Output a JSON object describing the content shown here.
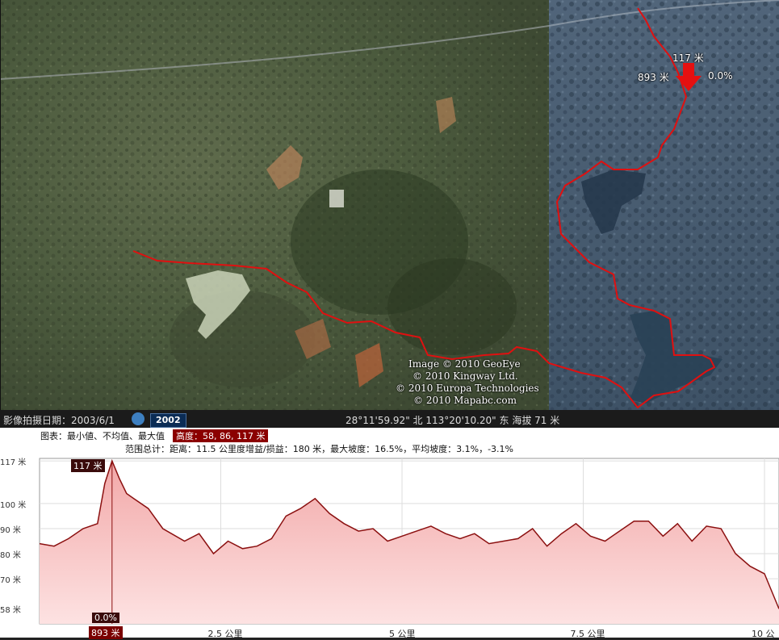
{
  "map": {
    "credits": [
      "Image © 2010 GeoEye",
      "© 2010 Kingway Ltd.",
      "© 2010 Europa Technologies",
      "© 2010 Mapabc.com"
    ],
    "marker": {
      "elevation": "117 米",
      "distance": "893 米",
      "slope": "0.0%"
    }
  },
  "status": {
    "imagery_date_label": "影像拍摄日期：2003/6/1",
    "year": "2002",
    "coords": "28°11'59.92\" 北  113°20'10.20\" 东 海拔   71 米"
  },
  "profile": {
    "header_left": "图表：最小値、不均值、最大值",
    "header_highlight": "高度：58, 86, 117 米",
    "summary": "范围总计：距离：11.5 公里度增益/损益：180 米，最大坡度：16.5%，平均坡度：3.1%，-3.1%",
    "cursor_elev": "117 米",
    "cursor_slope": "0.0%",
    "cursor_dist": "893 米"
  },
  "chart_data": {
    "type": "area",
    "title": "",
    "xlabel": "",
    "ylabel": "",
    "ylim": [
      52,
      118
    ],
    "xlim": [
      0,
      10.2
    ],
    "yticks": [
      "117 米",
      "100 米",
      "90 米",
      "80 米",
      "70 米",
      "58 米"
    ],
    "xticks": [
      "2.5 公里",
      "5 公里",
      "7.5 公里",
      "10 公"
    ],
    "x": [
      0,
      0.2,
      0.4,
      0.6,
      0.8,
      0.9,
      1.0,
      1.1,
      1.2,
      1.3,
      1.5,
      1.7,
      2.0,
      2.2,
      2.4,
      2.6,
      2.8,
      3.0,
      3.2,
      3.4,
      3.6,
      3.8,
      4.0,
      4.2,
      4.4,
      4.6,
      4.8,
      5.0,
      5.2,
      5.4,
      5.6,
      5.8,
      6.0,
      6.2,
      6.4,
      6.6,
      6.8,
      7.0,
      7.2,
      7.4,
      7.6,
      7.8,
      8.0,
      8.2,
      8.4,
      8.6,
      8.8,
      9.0,
      9.2,
      9.4,
      9.6,
      9.8,
      10.0,
      10.2
    ],
    "y": [
      84,
      83,
      86,
      90,
      92,
      108,
      117,
      110,
      104,
      102,
      98,
      90,
      85,
      88,
      80,
      85,
      82,
      83,
      86,
      95,
      98,
      102,
      96,
      92,
      89,
      90,
      85,
      87,
      89,
      91,
      88,
      86,
      88,
      84,
      85,
      86,
      90,
      83,
      88,
      92,
      87,
      85,
      89,
      93,
      93,
      87,
      92,
      85,
      91,
      90,
      80,
      75,
      72,
      58
    ]
  }
}
